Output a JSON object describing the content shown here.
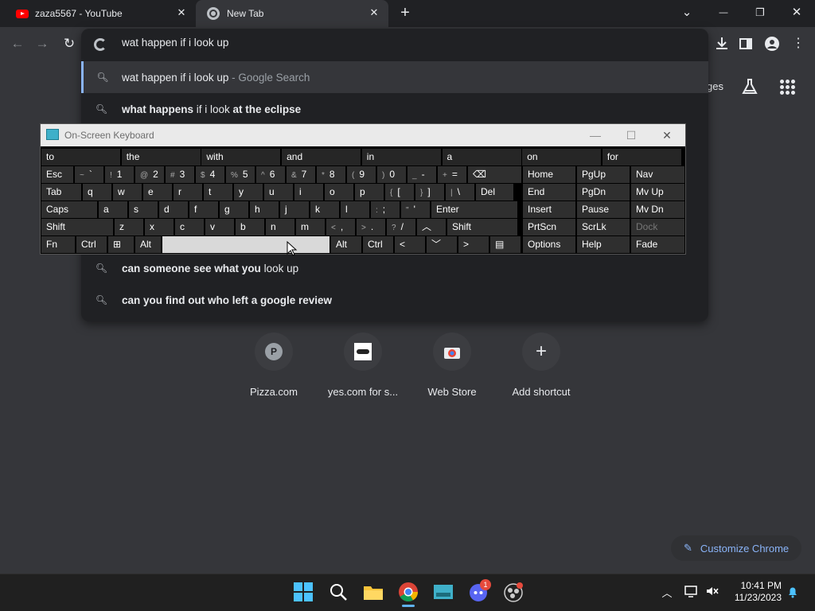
{
  "tabs": [
    {
      "title": "zaza5567 - YouTube",
      "icon": "youtube-icon"
    },
    {
      "title": "New Tab",
      "icon": "chrome-icon",
      "active": true
    }
  ],
  "new_tab_symbol": "+",
  "tab_close_symbol": "✕",
  "window_controls": {
    "dropdown": "⌄",
    "minimize": "—",
    "restore": "❐",
    "close": "✕"
  },
  "omnibox": {
    "input": "wat happen if i look up",
    "suggestions": [
      {
        "bold": "",
        "text": "wat happen if i look up",
        "tail": " - Google Search",
        "selected": true
      },
      {
        "bold": "what happens",
        "text": " if i look ",
        "bold2": "at the eclipse"
      },
      {
        "bold": "can someone see what you",
        "text": " look up"
      },
      {
        "bold": "can you find out who left a google review",
        "text": ""
      }
    ]
  },
  "toolbar_fragment": "ges",
  "osk": {
    "title": "On-Screen Keyboard",
    "predictions": [
      "to",
      "the",
      "with",
      "and",
      "in",
      "a",
      "on",
      "for"
    ],
    "row1": [
      {
        "l": "Esc"
      },
      {
        "s": "~",
        "l": "`"
      },
      {
        "s": "!",
        "l": "1"
      },
      {
        "s": "@",
        "l": "2"
      },
      {
        "s": "#",
        "l": "3"
      },
      {
        "s": "$",
        "l": "4"
      },
      {
        "s": "%",
        "l": "5"
      },
      {
        "s": "^",
        "l": "6"
      },
      {
        "s": "&",
        "l": "7"
      },
      {
        "s": "*",
        "l": "8"
      },
      {
        "s": "(",
        "l": "9"
      },
      {
        "s": ")",
        "l": "0"
      },
      {
        "s": "_",
        "l": "-"
      },
      {
        "s": "+",
        "l": "="
      },
      {
        "l": "⌫"
      }
    ],
    "row2": [
      {
        "l": "Tab"
      },
      {
        "l": "q"
      },
      {
        "l": "w"
      },
      {
        "l": "e"
      },
      {
        "l": "r"
      },
      {
        "l": "t"
      },
      {
        "l": "y"
      },
      {
        "l": "u"
      },
      {
        "l": "i"
      },
      {
        "l": "o"
      },
      {
        "l": "p"
      },
      {
        "s": "{",
        "l": "["
      },
      {
        "s": "}",
        "l": "]"
      },
      {
        "s": "|",
        "l": "\\"
      },
      {
        "l": "Del"
      }
    ],
    "row3": [
      {
        "l": "Caps"
      },
      {
        "l": "a"
      },
      {
        "l": "s"
      },
      {
        "l": "d"
      },
      {
        "l": "f"
      },
      {
        "l": "g"
      },
      {
        "l": "h"
      },
      {
        "l": "j"
      },
      {
        "l": "k"
      },
      {
        "l": "l"
      },
      {
        "s": ":",
        "l": ";"
      },
      {
        "s": "\"",
        "l": "'"
      },
      {
        "l": "Enter"
      }
    ],
    "row4": [
      {
        "l": "Shift"
      },
      {
        "l": "z"
      },
      {
        "l": "x"
      },
      {
        "l": "c"
      },
      {
        "l": "v"
      },
      {
        "l": "b"
      },
      {
        "l": "n"
      },
      {
        "l": "m"
      },
      {
        "s": "<",
        "l": ","
      },
      {
        "s": ">",
        "l": "."
      },
      {
        "s": "?",
        "l": "/"
      },
      {
        "l": "︿"
      },
      {
        "l": "Shift"
      }
    ],
    "row5": [
      {
        "l": "Fn"
      },
      {
        "l": "Ctrl"
      },
      {
        "l": "⊞"
      },
      {
        "l": "Alt"
      },
      {
        "l": ""
      },
      {
        "l": "Alt"
      },
      {
        "l": "Ctrl"
      },
      {
        "l": "<"
      },
      {
        "l": "﹀"
      },
      {
        "l": ">"
      },
      {
        "l": "▤"
      }
    ],
    "nav": [
      [
        "Home",
        "PgUp",
        "Nav"
      ],
      [
        "End",
        "PgDn",
        "Mv Up"
      ],
      [
        "Insert",
        "Pause",
        "Mv Dn"
      ],
      [
        "PrtScn",
        "ScrLk",
        "Dock"
      ],
      [
        "Options",
        "Help",
        "Fade"
      ]
    ]
  },
  "shortcuts": [
    {
      "label": "Pizza.com",
      "icon_letter": "P"
    },
    {
      "label": "yes.com for s...",
      "icon": "yes-com-icon"
    },
    {
      "label": "Web Store",
      "icon": "web-store-icon"
    },
    {
      "label": "Add shortcut",
      "icon_letter": "+"
    }
  ],
  "customize_label": "Customize Chrome",
  "clock": {
    "time": "10:41 PM",
    "date": "11/23/2023"
  },
  "discord_badge": "1",
  "colors": {
    "accent": "#8ab4f8",
    "youtube": "#ff0000"
  }
}
